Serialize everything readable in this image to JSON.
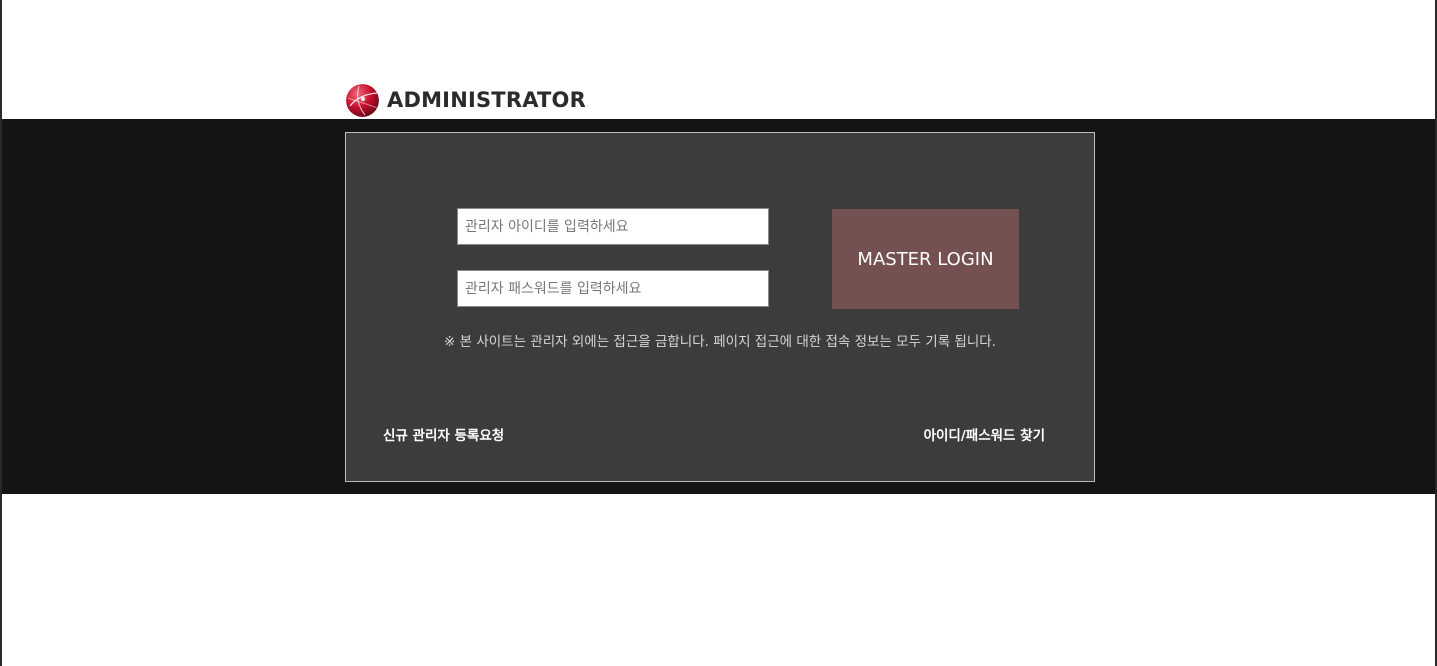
{
  "header": {
    "logo_icon": "red-globe-logo-icon",
    "title": "ADMINISTRATOR"
  },
  "login": {
    "id_placeholder": "관리자 아이디를 입력하세요",
    "password_placeholder": "관리자 패스워드를 입력하세요",
    "submit_label": "MASTER LOGIN",
    "notice": "※ 본 사이트는 관리자 외에는 접근을 금합니다. 페이지 접근에 대한 접속 정보는 모두 기록 됩니다."
  },
  "links": {
    "register": "신규 관리자 등록요청",
    "find_account": "아이디/패스워드 찾기"
  },
  "colors": {
    "band_background": "#141414",
    "panel_background": "#3c3c3c",
    "login_button": "#745050",
    "logo_red": "#c8102e"
  }
}
